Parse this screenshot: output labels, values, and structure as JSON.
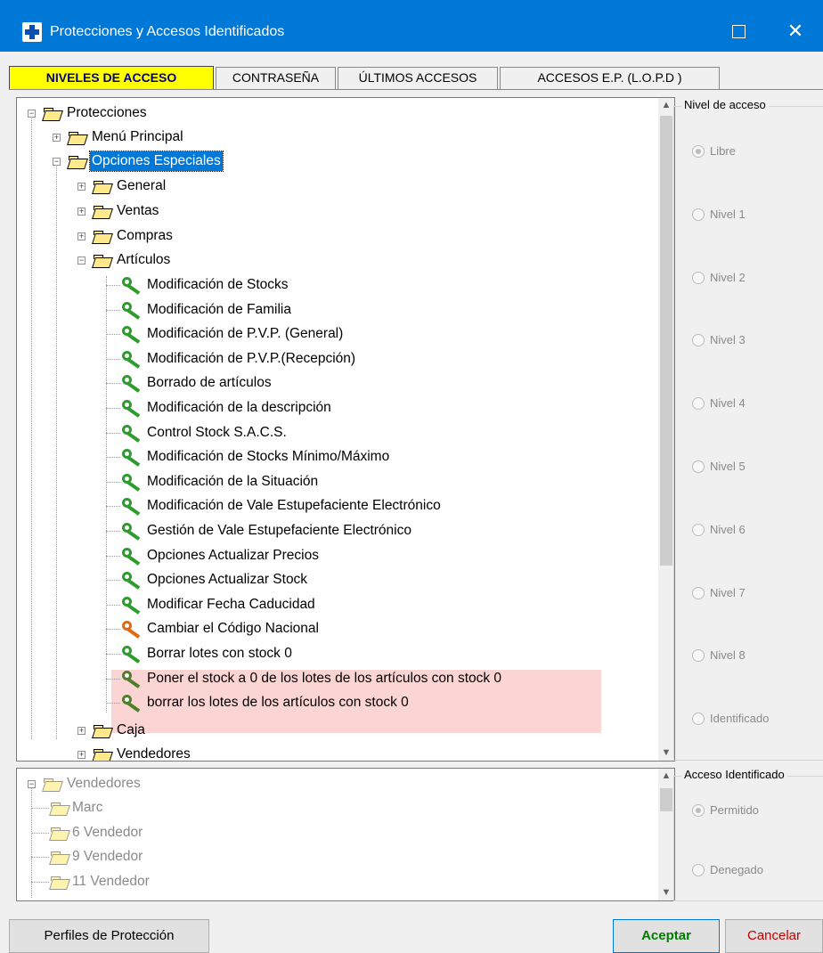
{
  "window": {
    "title": "Protecciones y Accesos Identificados",
    "maximize_glyph": "☐",
    "close_glyph": "✕"
  },
  "tabs": [
    {
      "label": "NIVELES DE ACCESO",
      "active": true
    },
    {
      "label": "CONTRASEÑA",
      "active": false
    },
    {
      "label": "ÚLTIMOS ACCESOS",
      "active": false
    },
    {
      "label": "ACCESOS E.P. (L.O.P.D )",
      "active": false
    }
  ],
  "tree": {
    "root": "Protecciones",
    "menu_principal": "Menú Principal",
    "opciones_especiales": "Opciones Especiales",
    "general": "General",
    "ventas": "Ventas",
    "compras": "Compras",
    "articulos": "Artículos",
    "articulos_items": [
      "Modificación de Stocks",
      "Modificación de Familia",
      "Modificación de P.V.P. (General)",
      "Modificación de P.V.P.(Recepción)",
      "Borrado de artículos",
      "Modificación de la descripción",
      "Control Stock S.A.C.S.",
      "Modificación de Stocks Mínimo/Máximo",
      "Modificación de la Situación",
      "Modificación de Vale Estupefaciente Electrónico",
      "Gestión de Vale Estupefaciente Electrónico",
      "Opciones Actualizar Precios",
      "Opciones Actualizar Stock",
      "Modificar Fecha Caducidad",
      "Cambiar el Código Nacional",
      "Borrar lotes con stock 0",
      "Poner el stock a 0 de los lotes de los artículos con stock 0",
      "borrar los lotes de los artículos con stock 0"
    ],
    "caja": "Caja",
    "vendedores": "Vendedores"
  },
  "vendors_tree": {
    "root": "Vendedores",
    "items": [
      "Marc",
      "6 Vendedor",
      "9 Vendedor",
      "11 Vendedor"
    ]
  },
  "nivel_acceso": {
    "label": "Nivel de acceso",
    "options": [
      "Libre",
      "Nivel 1",
      "Nivel 2",
      "Nivel 3",
      "Nivel 4",
      "Nivel 5",
      "Nivel 6",
      "Nivel 7",
      "Nivel 8",
      "Identificado"
    ],
    "selected": "Libre"
  },
  "acceso_identificado": {
    "label": "Acceso Identificado",
    "options": [
      "Permitido",
      "Denegado"
    ],
    "selected": "Permitido"
  },
  "buttons": {
    "perfiles": "Perfiles de Protección",
    "aceptar": "Aceptar",
    "cancelar": "Cancelar"
  },
  "scroll": {
    "up": "▲",
    "down": "▼"
  },
  "colors": {
    "title_bar": "#0078d7",
    "active_tab": "#ffff00",
    "key_green": "#2e9b2e",
    "key_orange": "#e06a10",
    "highlight": "#fbd5d3"
  }
}
